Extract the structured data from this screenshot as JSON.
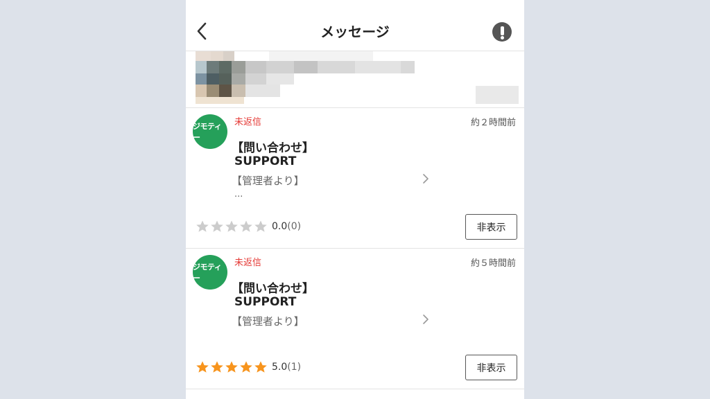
{
  "header": {
    "title": "メッセージ",
    "back_icon": "chevron-left-icon",
    "alert_icon": "exclamation-circle-icon"
  },
  "messages": [
    {
      "logo_text": "ジモティー",
      "status": "未返信",
      "time": "約２時間前",
      "subject": "【問い合わせ】",
      "sender": "SUPPORT",
      "preview": "【管理者より】",
      "ellipsis": "...",
      "rating_value": "0.0",
      "rating_count": "(0)",
      "stars_filled": 0,
      "hide_label": "非表示"
    },
    {
      "logo_text": "ジモティー",
      "status": "未返信",
      "time": "約５時間前",
      "subject": "【問い合わせ】",
      "sender": "SUPPORT",
      "preview": "【管理者より】",
      "rating_value": "5.0",
      "rating_count": "(1)",
      "stars_filled": 5,
      "hide_label": "非表示"
    }
  ],
  "colors": {
    "brand_green": "#25a05a",
    "unreplied_red": "#e53935",
    "star_filled": "#f7941d",
    "star_empty": "#cccccc"
  }
}
